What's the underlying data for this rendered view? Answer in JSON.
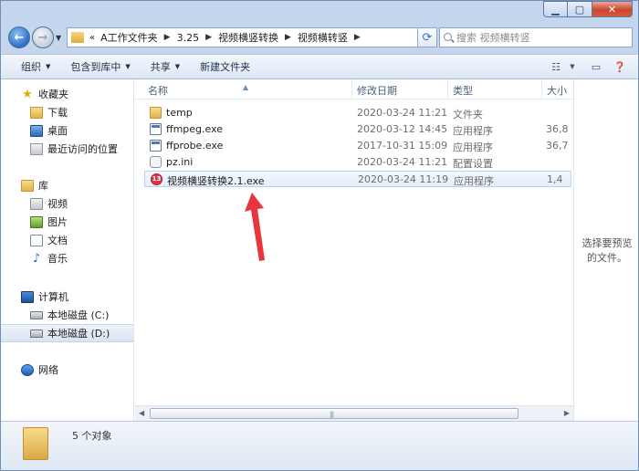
{
  "address": {
    "lead": "«",
    "crumbs": [
      "A工作文件夹",
      "3.25",
      "视频横竖转换",
      "视频横转竖"
    ]
  },
  "search": {
    "placeholder": "搜索 视频横转竖"
  },
  "toolbar": {
    "organize": "组织",
    "include_in_library": "包含到库中",
    "share": "共享",
    "new_folder": "新建文件夹"
  },
  "nav": {
    "favorites": "收藏夹",
    "downloads": "下载",
    "desktop": "桌面",
    "recent": "最近访问的位置",
    "libraries": "库",
    "videos": "视频",
    "pictures": "图片",
    "documents": "文档",
    "music": "音乐",
    "computer": "计算机",
    "drive_c": "本地磁盘 (C:)",
    "drive_d": "本地磁盘 (D:)",
    "network": "网络"
  },
  "columns": {
    "name": "名称",
    "date": "修改日期",
    "type": "类型",
    "size": "大小"
  },
  "files": [
    {
      "name": "temp",
      "date": "2020-03-24 11:21",
      "type": "文件夹",
      "size": "",
      "icon": "folder"
    },
    {
      "name": "ffmpeg.exe",
      "date": "2020-03-12 14:45",
      "type": "应用程序",
      "size": "36,8",
      "icon": "exe"
    },
    {
      "name": "ffprobe.exe",
      "date": "2017-10-31 15:09",
      "type": "应用程序",
      "size": "36,7",
      "icon": "exe"
    },
    {
      "name": "pz.ini",
      "date": "2020-03-24 11:21",
      "type": "配置设置",
      "size": "",
      "icon": "ini"
    },
    {
      "name": "视频横竖转换2.1.exe",
      "date": "2020-03-24 11:19",
      "type": "应用程序",
      "size": "1,4",
      "icon": "app"
    }
  ],
  "preview": {
    "text": "选择要预览的文件。"
  },
  "status": {
    "text": "5 个对象"
  },
  "colors": {
    "selection": "#e3edfa",
    "arrow": "#e8343c",
    "chrome": "#c5d6ee"
  }
}
